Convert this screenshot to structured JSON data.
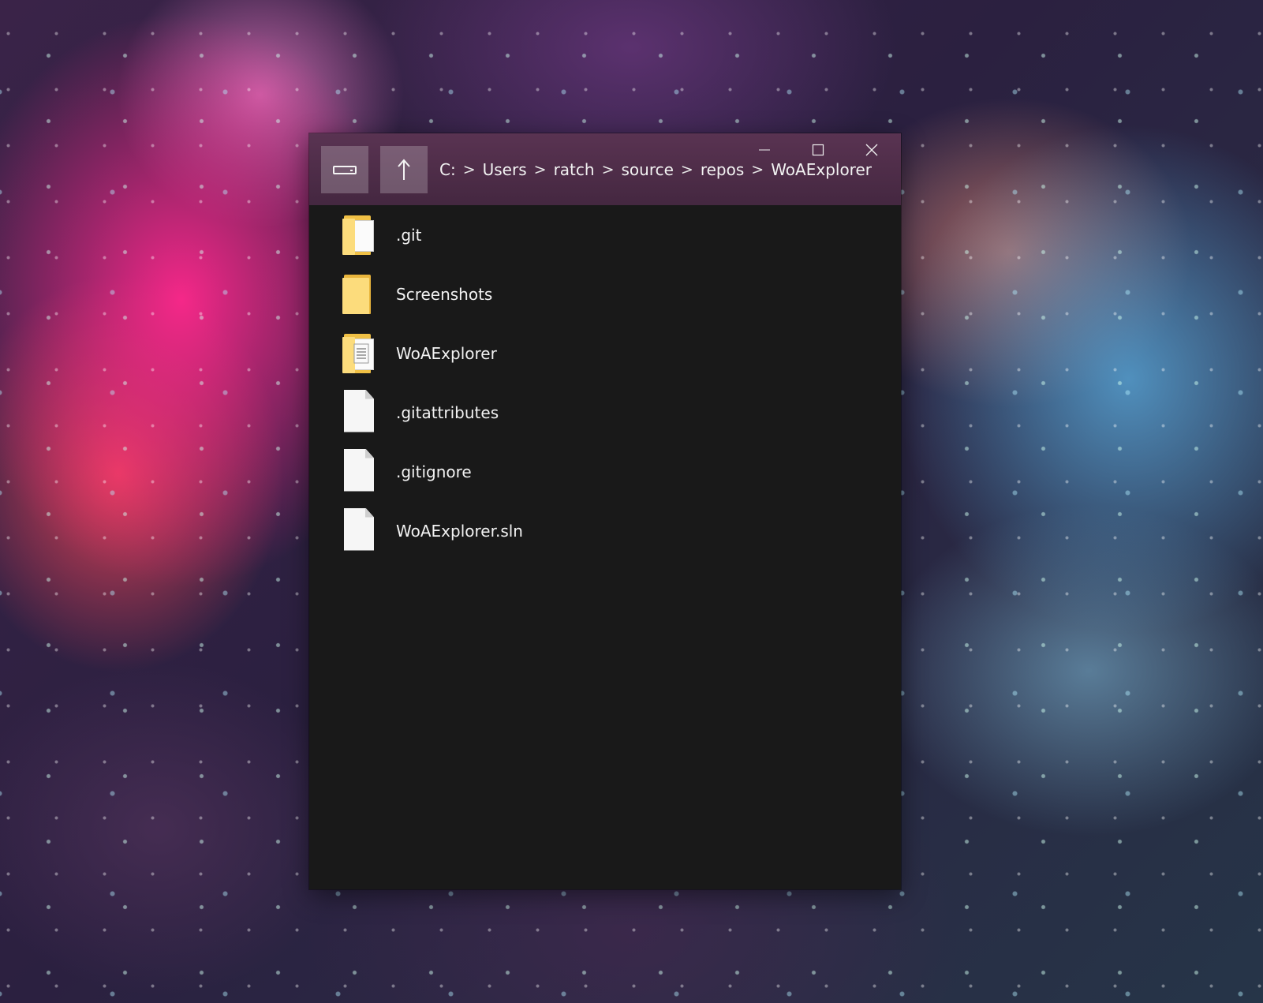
{
  "window": {
    "breadcrumb": [
      "C:",
      "Users",
      "ratch",
      "source",
      "repos",
      "WoAExplorer"
    ],
    "separator": ">"
  },
  "files": [
    {
      "name": ".git",
      "icon": "folder-with-file-icon"
    },
    {
      "name": "Screenshots",
      "icon": "folder-icon"
    },
    {
      "name": "WoAExplorer",
      "icon": "folder-with-file-icon"
    },
    {
      "name": ".gitattributes",
      "icon": "file-icon"
    },
    {
      "name": ".gitignore",
      "icon": "file-icon"
    },
    {
      "name": "WoAExplorer.sln",
      "icon": "file-icon"
    }
  ],
  "colors": {
    "titlebar": "#5c3454",
    "content_background": "#191919",
    "folder": "#fcdc7c",
    "text": "#f2f2f2"
  }
}
